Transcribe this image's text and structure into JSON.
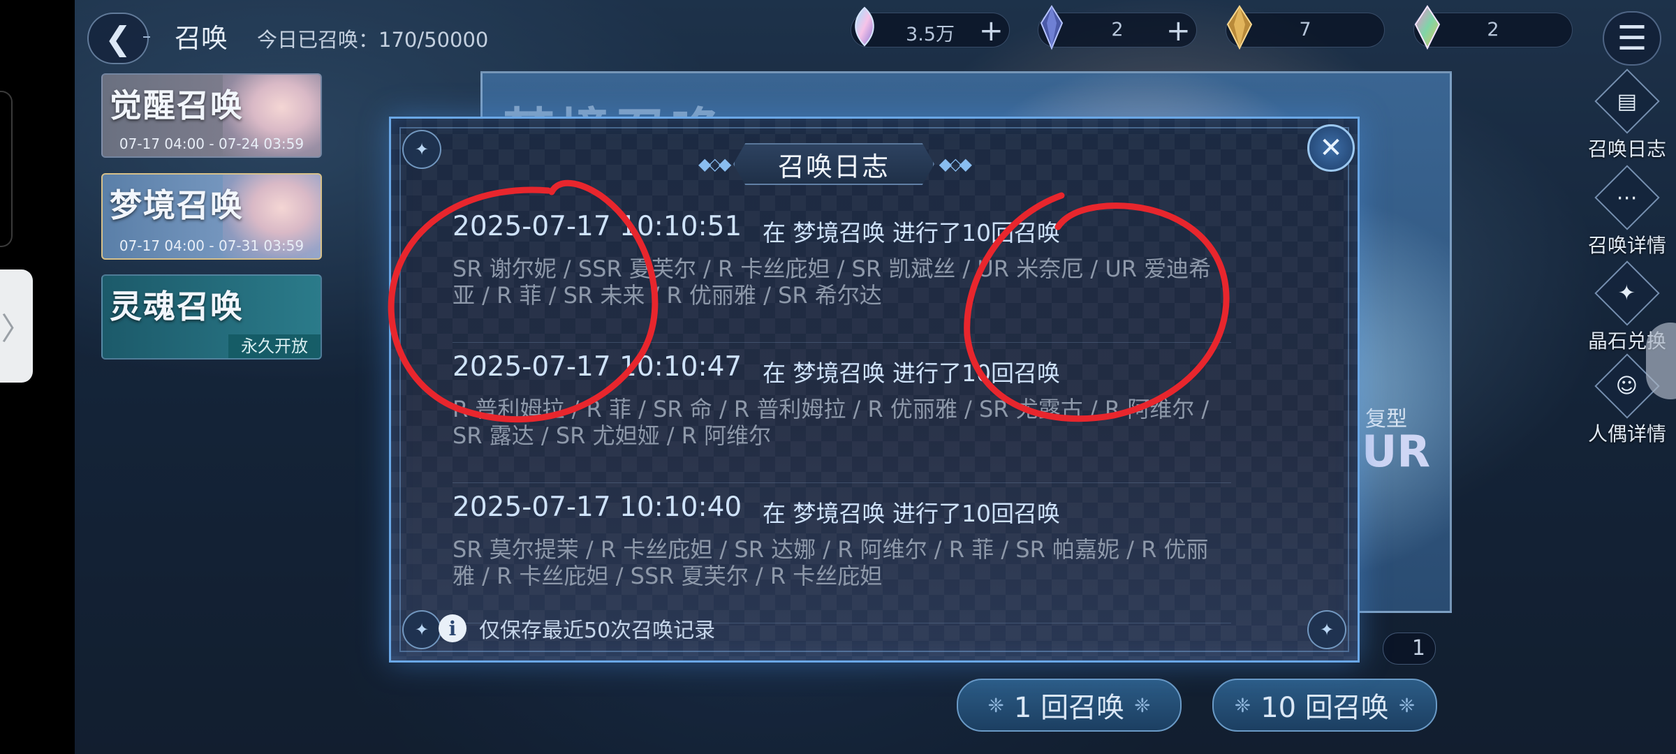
{
  "header": {
    "title": "召唤",
    "today_summons": "今日已召唤：170/50000"
  },
  "resources": [
    {
      "icon": "rainbow-orb-icon",
      "value": "3.5万",
      "has_plus": true
    },
    {
      "icon": "dark-crystal-icon",
      "value": "2",
      "has_plus": true
    },
    {
      "icon": "gold-crystal-icon",
      "value": "7",
      "has_plus": false
    },
    {
      "icon": "rainbow-crystal-icon",
      "value": "2",
      "has_plus": false
    }
  ],
  "banners": [
    {
      "name": "觉醒召唤",
      "date": "07-17 04:00 - 07-24 03:59",
      "selected": false
    },
    {
      "name": "梦境召唤",
      "date": "07-17 04:00 - 07-31 03:59",
      "selected": true
    },
    {
      "name": "灵魂召唤",
      "badge": "永久开放",
      "selected": false
    }
  ],
  "background_art": {
    "title_partial": "梦境召唤",
    "type_label": "复型",
    "rarity": "UR"
  },
  "sidebar": [
    {
      "icon": "log-book-icon",
      "label": "召唤日志"
    },
    {
      "icon": "more-dots-icon",
      "label": "召唤详情"
    },
    {
      "icon": "crystal-star-icon",
      "label": "晶石兑换"
    },
    {
      "icon": "person-search-icon",
      "label": "人偶详情"
    }
  ],
  "count_badge": "1",
  "pull_buttons": {
    "single": "1 回召唤",
    "ten": "10 回召唤"
  },
  "modal": {
    "title": "召唤日志",
    "entries": [
      {
        "time": "2025-07-17 10:10:51",
        "action": "在 梦境召唤 进行了10回召唤",
        "results": "SR  谢尔妮 / SSR  夏芙尔 / R  卡丝庇妲 / SR  凯斌丝 / UR  米奈厄 / UR  爱迪希亚 / R  菲 / SR  未来 / R  优丽雅 / SR  希尔达"
      },
      {
        "time": "2025-07-17 10:10:47",
        "action": "在 梦境召唤 进行了10回召唤",
        "results": "R  普利姆拉 / R  菲 / SR  命 / R  普利姆拉 / R  优丽雅 / SR  尤露古 / R  阿维尔 / SR  露达 / SR  尤妲娅 / R  阿维尔"
      },
      {
        "time": "2025-07-17 10:10:40",
        "action": "在 梦境召唤 进行了10回召唤",
        "results": "SR  莫尔提茉 / R  卡丝庇妲 / SR  达娜 / R  阿维尔 / R  菲 / SR  帕嘉妮 / R  优丽雅 / R  卡丝庇妲 / SSR  夏芙尔 / R  卡丝庇妲"
      }
    ],
    "footer_note": "仅保存最近50次召唤记录"
  },
  "colors": {
    "modal_border": "#6aa7e6",
    "entry_text": "#cfe3fb",
    "result_text": "#8e99aa",
    "annotation": "#e8262d"
  }
}
